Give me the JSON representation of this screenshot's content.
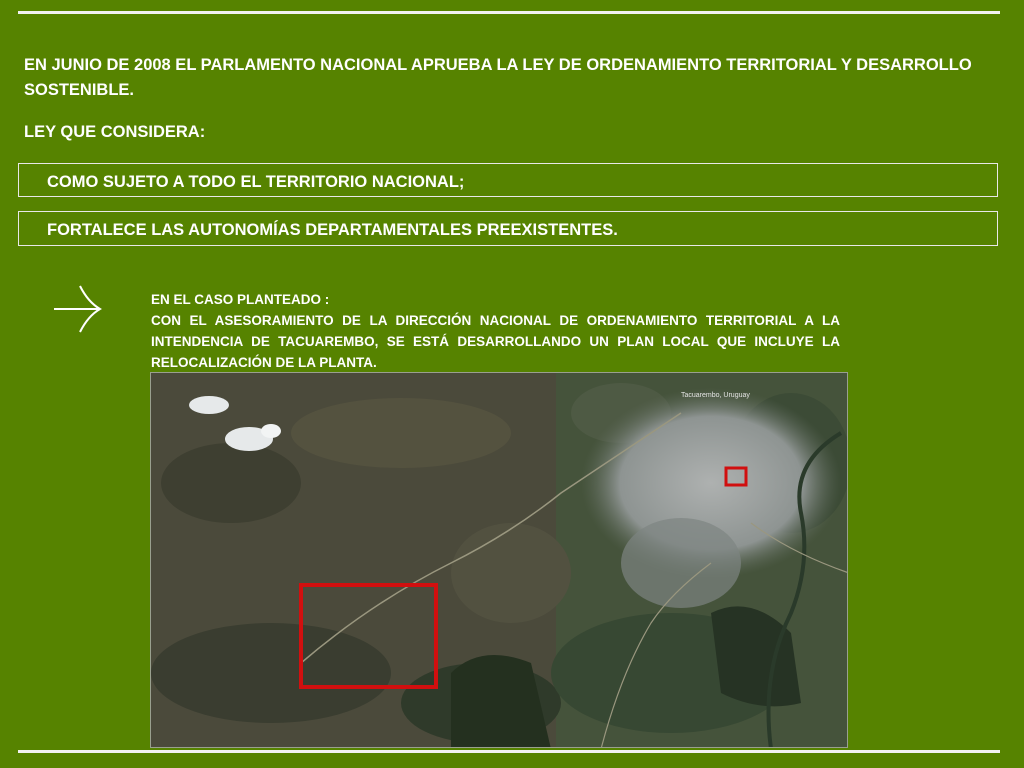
{
  "intro": "EN JUNIO DE  2008 EL PARLAMENTO NACIONAL APRUEBA LA LEY DE ORDENAMIENTO TERRITORIAL Y DESARROLLO SOSTENIBLE.",
  "law_heading": "LEY QUE CONSIDERA:",
  "considerations": [
    "COMO SUJETO A TODO EL TERRITORIO NACIONAL;",
    "FORTALECE LAS AUTONOMÍAS DEPARTAMENTALES PREEXISTENTES."
  ],
  "case": {
    "heading": "EN EL CASO PLANTEADO :",
    "body": "CON EL ASESORAMIENTO DE LA DIRECCIÓN NACIONAL DE ORDENAMIENTO TERRITORIAL A LA INTENDENCIA DE TACUAREMBO, SE ESTÁ DESARROLLANDO UN PLAN LOCAL QUE INCLUYE LA RELOCALIZACIÓN DE LA PLANTA."
  },
  "map": {
    "city_label": "Tacuarembo, Uruguay",
    "highlight_color": "#d10f0f"
  },
  "colors": {
    "background": "#568300",
    "text": "#ffffff"
  },
  "icons": {
    "arrow": "right-arrow-icon"
  }
}
